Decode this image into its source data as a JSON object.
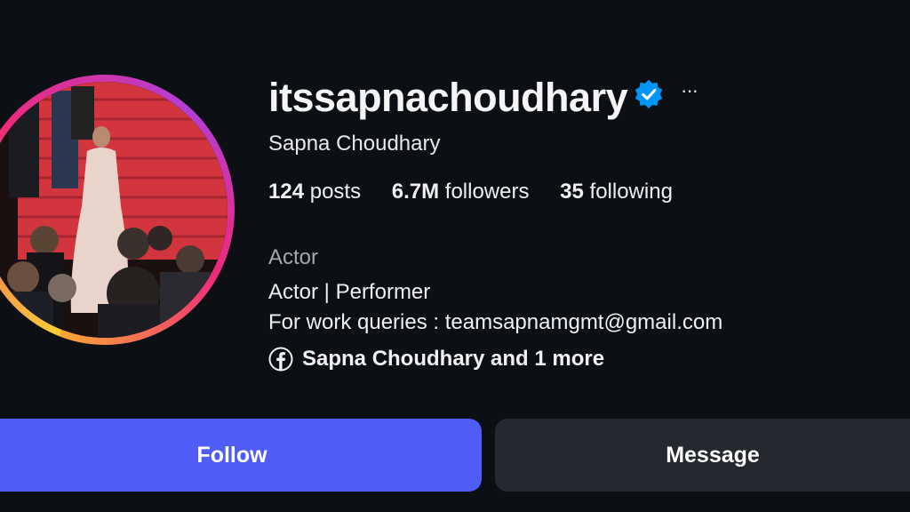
{
  "profile": {
    "username": "itssapnachoudhary",
    "verified": true,
    "more_label": "···",
    "full_name": "Sapna Choudhary",
    "stats": {
      "posts_count": "124",
      "posts_label": " posts",
      "followers_count": "6.7M",
      "followers_label": " followers",
      "following_count": "35",
      "following_label": " following"
    },
    "category": "Actor",
    "bio_line1": "Actor | Performer",
    "bio_line2": "For work queries : teamsapnamgmt@gmail.com",
    "links_text": "Sapna Choudhary and 1 more"
  },
  "actions": {
    "follow_label": "Follow",
    "message_label": "Message"
  },
  "icons": {
    "verified": "verified-badge-icon",
    "more": "more-options-icon",
    "facebook": "facebook-icon"
  },
  "colors": {
    "background": "#0c0f14",
    "follow_button": "#4f5cf6",
    "message_button": "#25282e",
    "verified_badge": "#0095f6",
    "secondary_text": "#a8a8a8"
  }
}
